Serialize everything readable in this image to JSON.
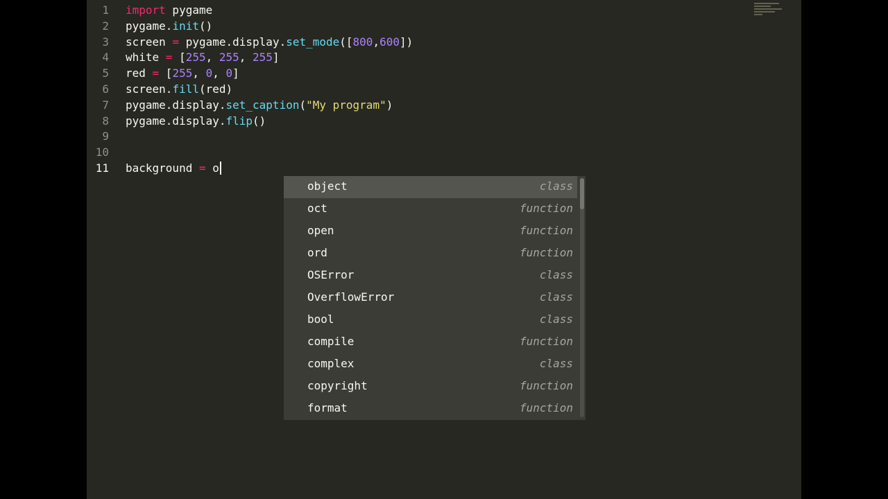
{
  "editor": {
    "lines": [
      {
        "num": "1",
        "t": [
          [
            "import",
            "kw"
          ],
          [
            " pygame",
            ""
          ]
        ]
      },
      {
        "num": "2",
        "t": [
          [
            "pygame.",
            ""
          ],
          [
            "init",
            "fn"
          ],
          [
            "()",
            ""
          ]
        ]
      },
      {
        "num": "3",
        "t": [
          [
            "screen ",
            ""
          ],
          [
            "=",
            "kw"
          ],
          [
            " pygame.display.",
            ""
          ],
          [
            "set_mode",
            "fn"
          ],
          [
            "([",
            ""
          ],
          [
            "800",
            "num"
          ],
          [
            ",",
            ""
          ],
          [
            "600",
            "num"
          ],
          [
            "])",
            ""
          ]
        ]
      },
      {
        "num": "4",
        "t": [
          [
            "white ",
            ""
          ],
          [
            "=",
            "kw"
          ],
          [
            " [",
            ""
          ],
          [
            "255",
            "num"
          ],
          [
            ", ",
            ""
          ],
          [
            "255",
            "num"
          ],
          [
            ", ",
            ""
          ],
          [
            "255",
            "num"
          ],
          [
            "]",
            ""
          ]
        ]
      },
      {
        "num": "5",
        "t": [
          [
            "red ",
            ""
          ],
          [
            "=",
            "kw"
          ],
          [
            " [",
            ""
          ],
          [
            "255",
            "num"
          ],
          [
            ", ",
            ""
          ],
          [
            "0",
            "num"
          ],
          [
            ", ",
            ""
          ],
          [
            "0",
            "num"
          ],
          [
            "]",
            ""
          ]
        ]
      },
      {
        "num": "6",
        "t": [
          [
            "screen.",
            ""
          ],
          [
            "fill",
            "fn"
          ],
          [
            "(red)",
            ""
          ]
        ]
      },
      {
        "num": "7",
        "t": [
          [
            "pygame.display.",
            ""
          ],
          [
            "set_caption",
            "fn"
          ],
          [
            "(",
            ""
          ],
          [
            "\"My program\"",
            "str"
          ],
          [
            ")",
            ""
          ]
        ]
      },
      {
        "num": "8",
        "t": [
          [
            "pygame.display.",
            ""
          ],
          [
            "flip",
            "fn"
          ],
          [
            "()",
            ""
          ]
        ]
      },
      {
        "num": "9",
        "t": []
      },
      {
        "num": "10",
        "t": []
      },
      {
        "num": "11",
        "t": [
          [
            "background ",
            ""
          ],
          [
            "=",
            "kw"
          ],
          [
            " o",
            ""
          ]
        ],
        "cursor": true
      }
    ]
  },
  "autocomplete": {
    "items": [
      {
        "name": "object",
        "kind": "class",
        "selected": true
      },
      {
        "name": "oct",
        "kind": "function"
      },
      {
        "name": "open",
        "kind": "function"
      },
      {
        "name": "ord",
        "kind": "function"
      },
      {
        "name": "OSError",
        "kind": "class"
      },
      {
        "name": "OverflowError",
        "kind": "class"
      },
      {
        "name": "bool",
        "kind": "class"
      },
      {
        "name": "compile",
        "kind": "function"
      },
      {
        "name": "complex",
        "kind": "class"
      },
      {
        "name": "copyright",
        "kind": "function"
      },
      {
        "name": "format",
        "kind": "function"
      }
    ]
  },
  "colors": {
    "background": "#272822",
    "keyword": "#f92672",
    "function": "#66d9ef",
    "number": "#ae81ff",
    "string": "#e6db74"
  }
}
